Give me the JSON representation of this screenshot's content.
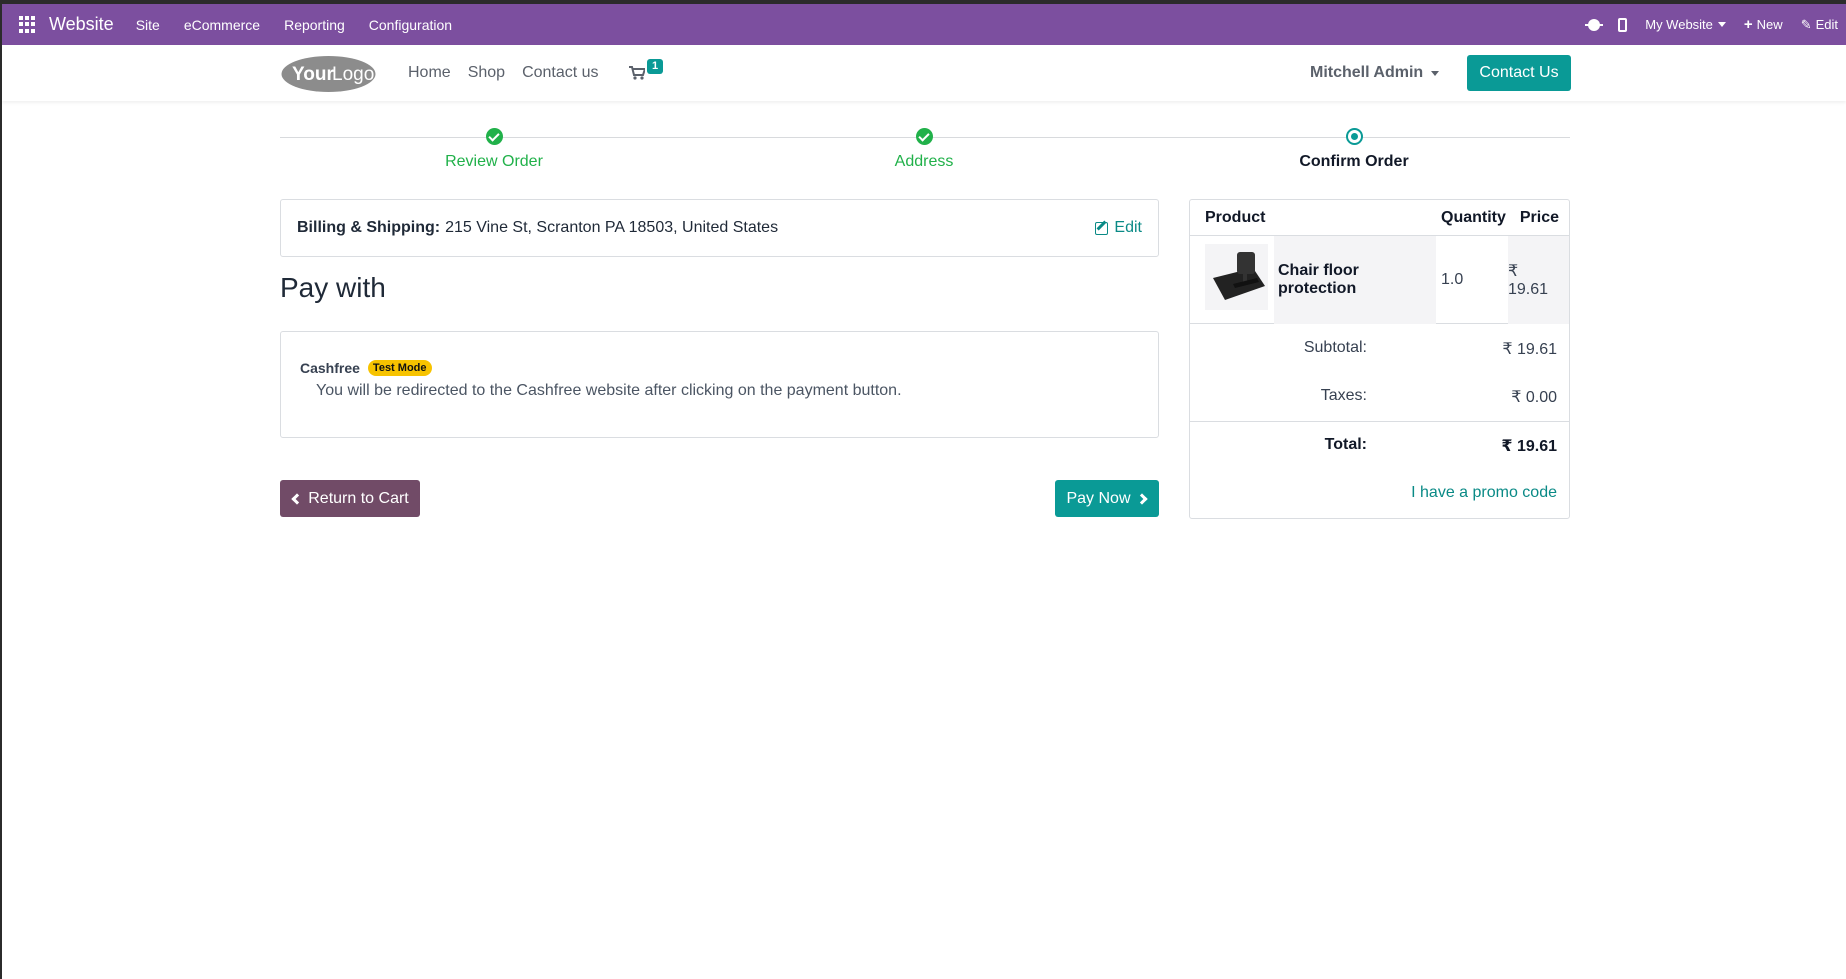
{
  "admin_bar": {
    "brand": "Website",
    "menu": [
      "Site",
      "eCommerce",
      "Reporting",
      "Configuration"
    ],
    "website_switch": "My Website",
    "new_label": "New",
    "edit_label": "Edit"
  },
  "header": {
    "logo_alt": "YourLogo",
    "nav": [
      "Home",
      "Shop",
      "Contact us"
    ],
    "cart_count": "1",
    "user_name": "Mitchell Admin",
    "contact_button": "Contact Us"
  },
  "steps": [
    {
      "label": "Review Order",
      "state": "done"
    },
    {
      "label": "Address",
      "state": "done"
    },
    {
      "label": "Confirm Order",
      "state": "current"
    }
  ],
  "billing": {
    "label": "Billing & Shipping:",
    "address": "215 Vine St, Scranton PA 18503, United States",
    "edit_label": "Edit"
  },
  "payment": {
    "heading": "Pay with",
    "provider": "Cashfree",
    "badge": "Test Mode",
    "description": "You will be redirected to the Cashfree website after clicking on the payment button."
  },
  "actions": {
    "return_label": "Return to Cart",
    "pay_label": "Pay Now"
  },
  "summary": {
    "headers": {
      "product": "Product",
      "quantity": "Quantity",
      "price": "Price"
    },
    "lines": [
      {
        "name": "Chair floor protection",
        "quantity": "1.0",
        "price": "₹ 19.61"
      }
    ],
    "subtotal_label": "Subtotal:",
    "subtotal": "₹ 19.61",
    "taxes_label": "Taxes:",
    "taxes": "₹ 0.00",
    "total_label": "Total:",
    "total": "₹ 19.61",
    "promo_label": "I have a promo code"
  },
  "colors": {
    "admin_bar": "#7c4f9f",
    "primary": "#0a9a96",
    "secondary": "#714b67",
    "success": "#21b14a",
    "badge_warning": "#f7c300"
  }
}
